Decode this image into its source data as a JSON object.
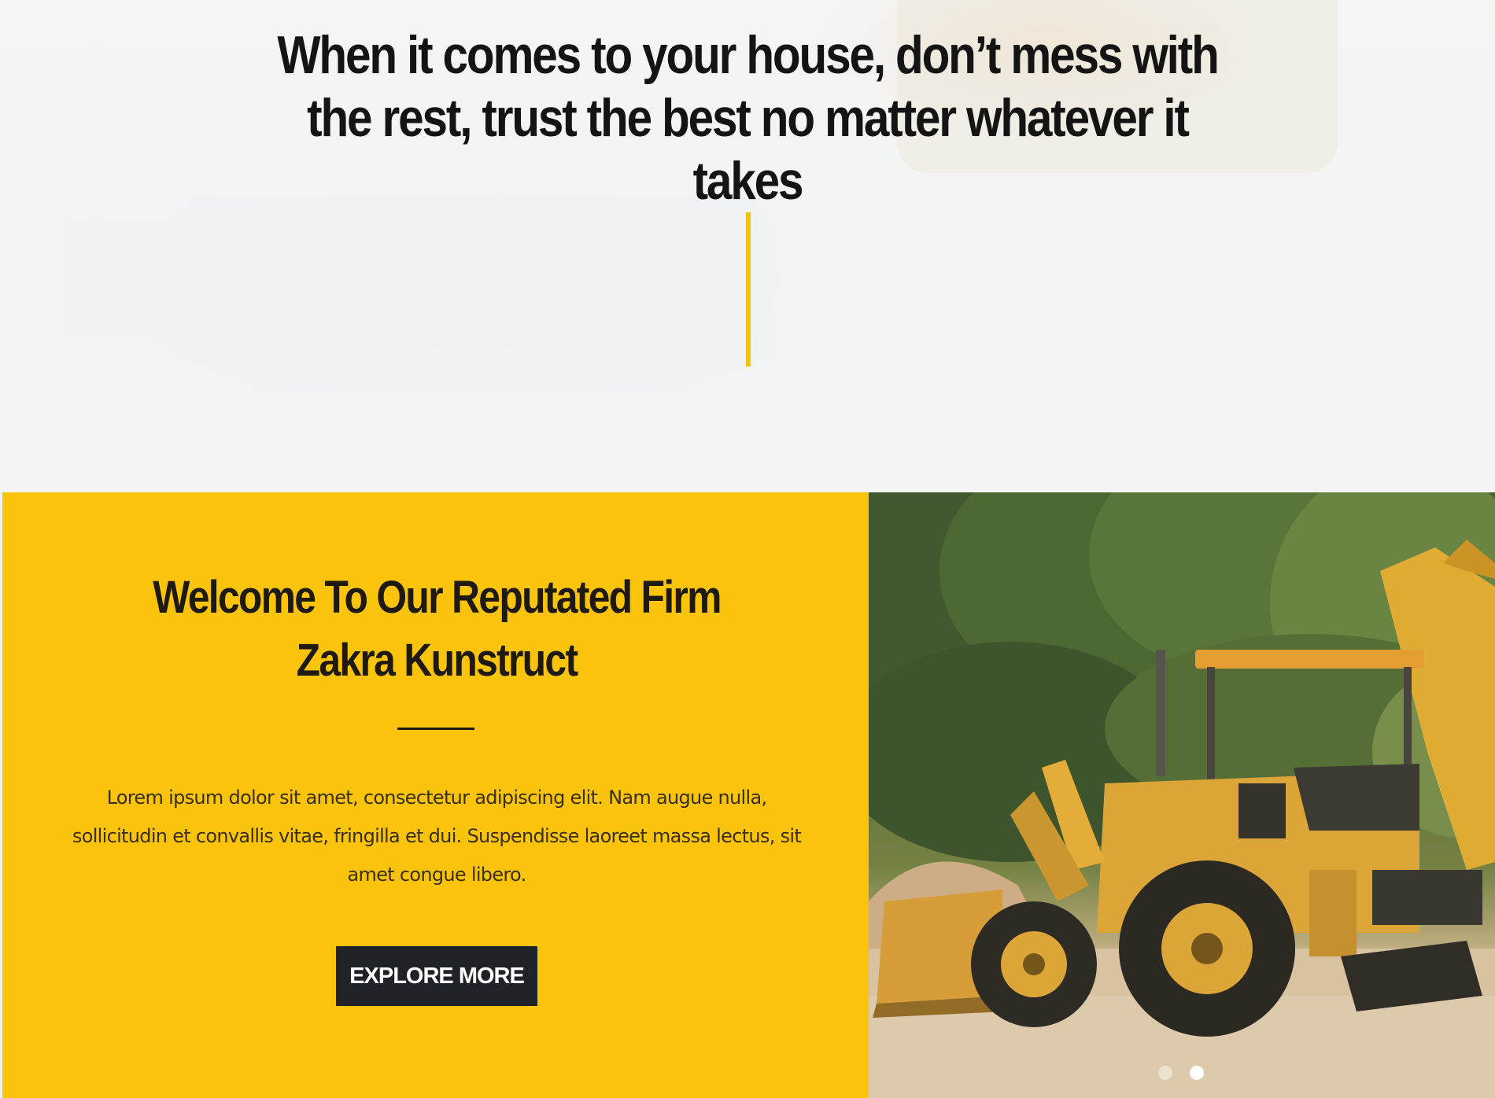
{
  "hero": {
    "title": "When it comes to your house, don’t mess with the rest, trust the best no matter whatever it takes"
  },
  "welcome": {
    "title": "Welcome To Our Reputated Firm Zakra Kunstruct",
    "text": "Lorem ipsum dolor sit amet, consectetur adipiscing elit. Nam augue nulla, sollicitudin et convallis vitae, fringilla et dui. Suspendisse laoreet massa lectus, sit amet congue libero.",
    "button_label": "EXPLORE MORE"
  },
  "slider": {
    "slide_count": 2,
    "active_slide": 2,
    "slides": [
      {
        "image": "backhoe-loader-photo"
      },
      {
        "image": "backhoe-loader-photo"
      }
    ]
  },
  "colors": {
    "accent_yellow": "#fbc40c",
    "divider_yellow": "#f6c10a",
    "button_dark": "#1f2328",
    "heading_dark": "#141414"
  }
}
